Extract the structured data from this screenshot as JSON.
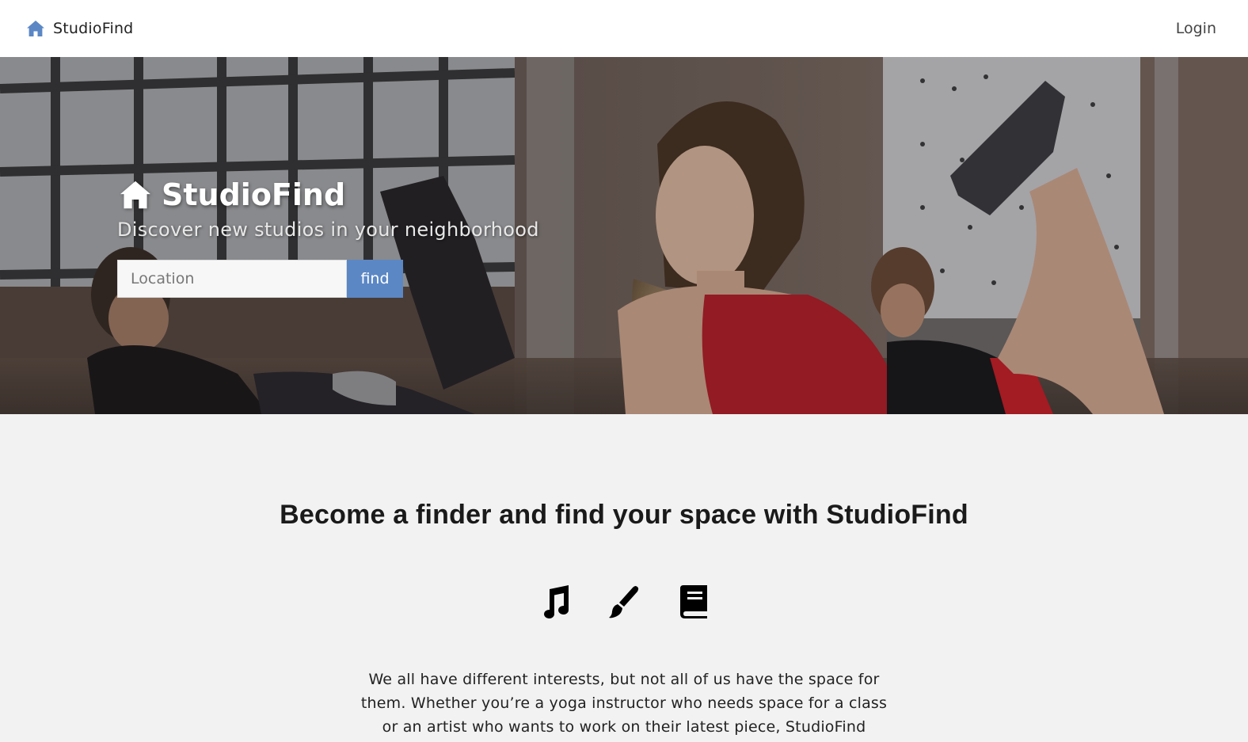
{
  "navbar": {
    "brand_icon": "home-icon",
    "brand_name": "StudioFind",
    "login_label": "Login",
    "accent_color": "#5b87c5"
  },
  "hero": {
    "icon": "home-icon",
    "title": "StudioFind",
    "subtitle": "Discover new studios in your neighborhood",
    "search": {
      "placeholder": "Location",
      "value": "",
      "button_label": "find"
    }
  },
  "intro": {
    "heading": "Become a finder and find your space with StudioFind",
    "icons": [
      "music-note-icon",
      "paint-brush-icon",
      "book-icon"
    ],
    "text": "We all have different interests, but not all of us have the space for them. Whether you’re a yoga instructor who needs space for a class or an artist who wants to work on their latest piece, StudioFind"
  }
}
